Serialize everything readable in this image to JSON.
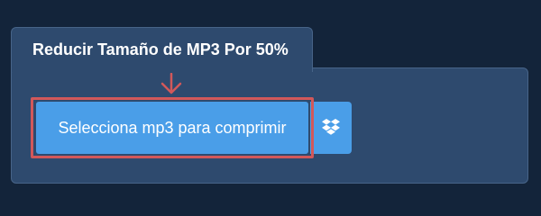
{
  "panel": {
    "title": "Reducir Tamaño de MP3 Por 50%"
  },
  "upload": {
    "label": "Selecciona mp3 para comprimir"
  },
  "icons": {
    "dropbox": "dropbox-icon",
    "arrow": "arrow-down-icon"
  },
  "colors": {
    "page_background": "#13243a",
    "panel_background": "#2e4a6e",
    "button_background": "#4a9ee8",
    "highlight": "#d2585a"
  }
}
